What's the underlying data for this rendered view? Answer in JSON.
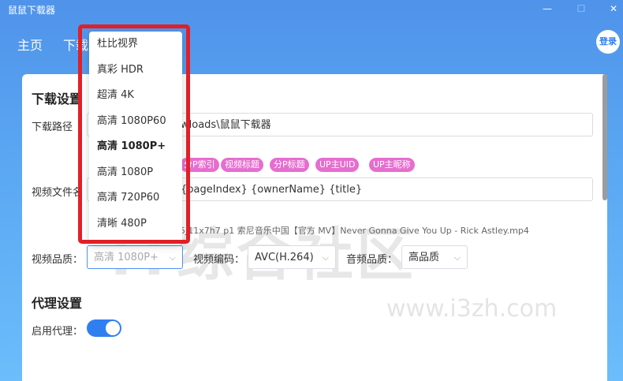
{
  "window": {
    "title": "鼠鼠下载器",
    "minimize": "—",
    "maximize": "☐",
    "close": "✕"
  },
  "nav": {
    "items": [
      "主页",
      "下载"
    ],
    "login": "登录"
  },
  "download_settings": {
    "title": "下载设置",
    "path_label": "下载路径",
    "path_value": "wloads\\鼠鼠下载器",
    "filename_label": "视频文件名",
    "tags": [
      "分P索引",
      "视频标题",
      "分P标题",
      "UP主UID",
      "UP主昵称"
    ],
    "filename_value": "{pageIndex} {ownerName} {title}",
    "filename_preview": "5J11x7h7 p1 索尼音乐中国【官方 MV】Never Gonna Give You Up - Rick Astley.mp4",
    "quality_label": "视频品质：",
    "quality_value": "高清 1080P+",
    "codec_label": "视频编码：",
    "codec_value": "AVC(H.264)",
    "audio_label": "音频品质：",
    "audio_value": "高品质"
  },
  "proxy_settings": {
    "title": "代理设置",
    "enable_label": "启用代理：",
    "enabled": true
  },
  "quality_dropdown": {
    "options": [
      "杜比视界",
      "真彩 HDR",
      "超清 4K",
      "高清 1080P60",
      "高清 1080P+",
      "高清 1080P",
      "高清 720P60",
      "清晰 480P"
    ],
    "selected": "高清 1080P+"
  },
  "watermark": {
    "text": "IT综合社区",
    "url": "www.i3zh.com"
  },
  "colors": {
    "accent": "#2f7ff0",
    "tag": "#e66ecf",
    "highlight_border": "#e21f26"
  }
}
